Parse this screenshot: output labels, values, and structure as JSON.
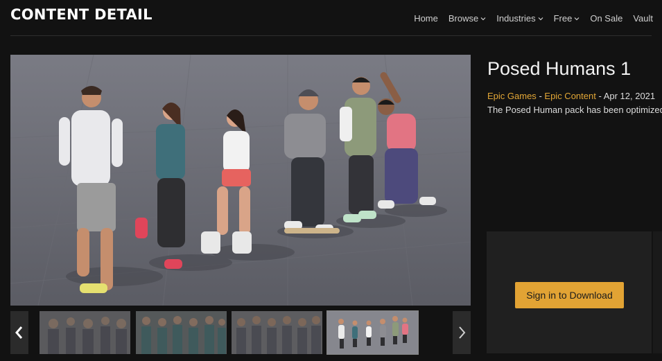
{
  "header": {
    "brand": "CONTENT DETAIL",
    "nav": [
      {
        "label": "Home",
        "dropdown": false
      },
      {
        "label": "Browse",
        "dropdown": true
      },
      {
        "label": "Industries",
        "dropdown": true
      },
      {
        "label": "Free",
        "dropdown": true
      },
      {
        "label": "On Sale",
        "dropdown": false
      },
      {
        "label": "Vault",
        "dropdown": false
      }
    ]
  },
  "product": {
    "title": "Posed Humans 1",
    "seller": "Epic Games",
    "separator": "-",
    "category": "Epic Content",
    "date": "- Apr 12, 2021",
    "description": "The Posed Human pack has been optimized"
  },
  "gallery": {
    "prev_icon": "chevron-left-icon",
    "next_icon": "chevron-right-icon",
    "active_thumb": 4,
    "thumb_count": 4
  },
  "actions": {
    "sign_in_label": "Sign in to Download"
  },
  "colors": {
    "accent": "#e2a334",
    "background": "#121212"
  }
}
